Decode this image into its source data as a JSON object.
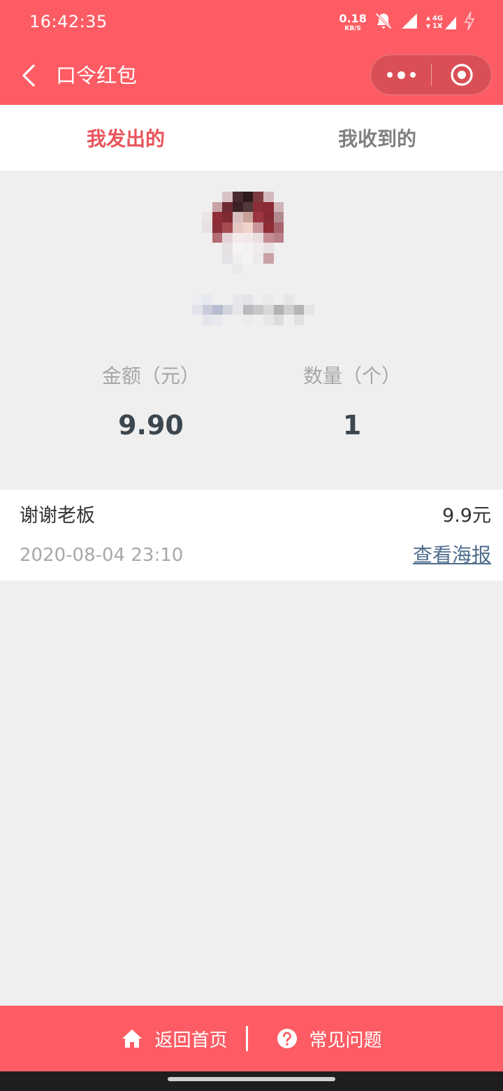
{
  "status_bar": {
    "time": "16:42:35",
    "net_speed_value": "0.18",
    "net_speed_unit": "KB/S",
    "network_label_top": "4G",
    "network_label_bottom": "1X"
  },
  "title_bar": {
    "title": "口令红包"
  },
  "tabs": [
    {
      "label": "我发出的",
      "active": true
    },
    {
      "label": "我收到的",
      "active": false
    }
  ],
  "summary": {
    "amount_label": "金额（元）",
    "amount_value": "9.90",
    "count_label": "数量（个）",
    "count_value": "1"
  },
  "record": {
    "message": "谢谢老板",
    "amount": "9.9元",
    "date": "2020-08-04 23:10",
    "poster_link": "查看海报"
  },
  "bottom_bar": {
    "home_label": "返回首页",
    "faq_label": "常见问题"
  },
  "colors": {
    "brand": "#fe5c64",
    "active_tab": "#e9545b",
    "link": "#4f6d8d",
    "background": "#efefef"
  }
}
